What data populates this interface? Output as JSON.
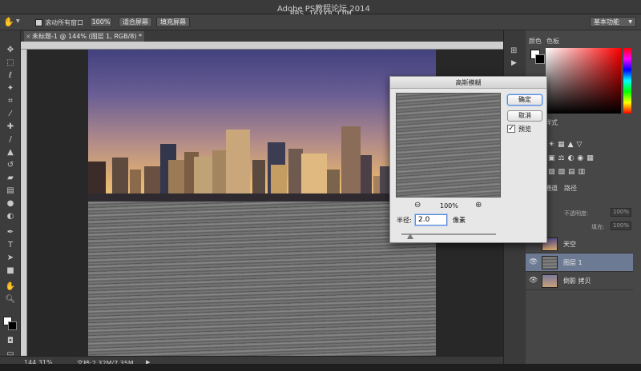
{
  "window": {
    "title": "Adobe PS教程论坛 2014",
    "watermark": "BBS.16XX8.COM"
  },
  "options_bar": {
    "scroll_all_label": "滚动所有窗口",
    "btn_100": "100%",
    "btn_fit": "适合屏幕",
    "btn_fill": "填充屏幕",
    "workspace": "基本功能"
  },
  "document": {
    "tab_label": "未标题-1 @ 144% (图层 1, RGB/8) *"
  },
  "status": {
    "zoom": "144.31%",
    "doc_size": "文档:2.32M/7.35M"
  },
  "panels": {
    "color_tab": "颜色",
    "swatch_tab": "色板",
    "styles_tab": "样式",
    "channels_tab": "通道",
    "paths_tab": "路径",
    "opacity_label": "不透明度:",
    "opacity_value": "100%",
    "fill_label": "填充:",
    "fill_value": "100%",
    "layers": [
      {
        "name": "天空",
        "selected": false,
        "visible": false
      },
      {
        "name": "图层 1",
        "selected": true,
        "visible": true
      },
      {
        "name": "倒影 拷贝",
        "selected": false,
        "visible": true
      }
    ]
  },
  "dialog": {
    "title": "高斯模糊",
    "ok": "确定",
    "cancel": "取消",
    "preview_label": "预览",
    "preview_checked": true,
    "zoom_value": "100%",
    "radius_label": "半径:",
    "radius_value": "2.0",
    "radius_unit": "像素"
  },
  "icons": {
    "toolbar": [
      "move-icon",
      "marquee-icon",
      "lasso-icon",
      "magic-wand-icon",
      "crop-icon",
      "eyedropper-icon",
      "healing-brush-icon",
      "brush-icon",
      "clone-stamp-icon",
      "history-brush-icon",
      "eraser-icon",
      "gradient-icon",
      "blur-icon",
      "dodge-icon",
      "pen-icon",
      "type-icon",
      "path-select-icon",
      "shape-icon",
      "hand-icon",
      "zoom-icon"
    ]
  }
}
